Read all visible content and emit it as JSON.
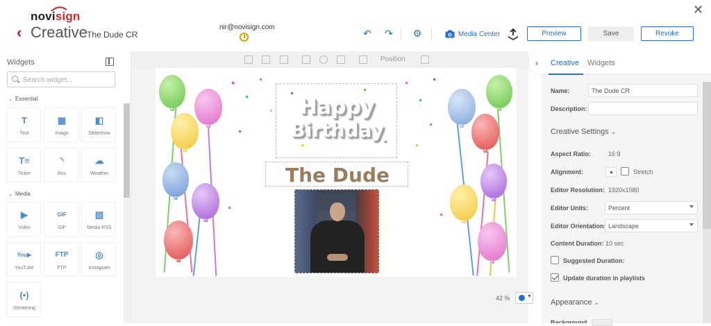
{
  "header": {
    "logo_part1": "novi",
    "logo_part2": "sign",
    "title": "Creative",
    "creative_name": "The Dude CR",
    "user_email": "nir@novisign.com",
    "media_center_label": "Media Center",
    "preview_label": "Preview",
    "save_label": "Save",
    "revoke_label": "Revoke",
    "accent_color": "#1e6fd9",
    "brand_color": "#d7262c"
  },
  "widgets_panel": {
    "title": "Widgets",
    "search_placeholder": "Search widget...",
    "categories": [
      {
        "name": "Essential",
        "items": [
          {
            "label": "Text",
            "icon": "text-icon"
          },
          {
            "label": "Image",
            "icon": "image-icon"
          },
          {
            "label": "Slideshow",
            "icon": "slideshow-icon"
          },
          {
            "label": "Ticker",
            "icon": "ticker-icon"
          },
          {
            "label": "Rss",
            "icon": "rss-icon"
          },
          {
            "label": "Weather",
            "icon": "weather-icon"
          }
        ]
      },
      {
        "name": "Media",
        "items": [
          {
            "label": "Video",
            "icon": "video-icon"
          },
          {
            "label": "GIF",
            "icon": "gif-icon"
          },
          {
            "label": "Media RSS",
            "icon": "media-rss-icon"
          },
          {
            "label": "YouTube",
            "icon": "youtube-icon"
          },
          {
            "label": "FTP",
            "icon": "ftp-icon"
          },
          {
            "label": "Instagram",
            "icon": "instagram-icon"
          },
          {
            "label": "Streaming",
            "icon": "streaming-icon"
          }
        ]
      }
    ]
  },
  "canvas_toolbar": {
    "position_label": "Position"
  },
  "canvas": {
    "greeting_line1": "Happy",
    "greeting_line2": "Birthday",
    "name_text": "The Dude",
    "zoom_label": "42 %"
  },
  "properties_panel": {
    "tabs": [
      {
        "label": "Creative",
        "active": true
      },
      {
        "label": "Widgets",
        "active": false
      }
    ],
    "name_label": "Name:",
    "name_value": "The Dude CR",
    "description_label": "Description:",
    "description_value": "",
    "creative_settings_label": "Creative Settings",
    "aspect_ratio_label": "Aspect Ratio:",
    "aspect_ratio_value": "16:9",
    "alignment_label": "Alignment:",
    "stretch_label": "Stretch",
    "editor_resolution_label": "Editor Resolution:",
    "editor_resolution_value": "1920x1080",
    "editor_units_label": "Editor Units:",
    "editor_units_value": "Percent",
    "editor_orientation_label": "Editor Orientation:",
    "editor_orientation_value": "Landscape",
    "content_duration_label": "Content Duration:",
    "content_duration_value": "10 sec",
    "suggested_duration_label": "Suggested Duration:",
    "update_duration_label": "Update duration in playlists",
    "appearance_label": "Appearance",
    "background_label": "Background"
  }
}
